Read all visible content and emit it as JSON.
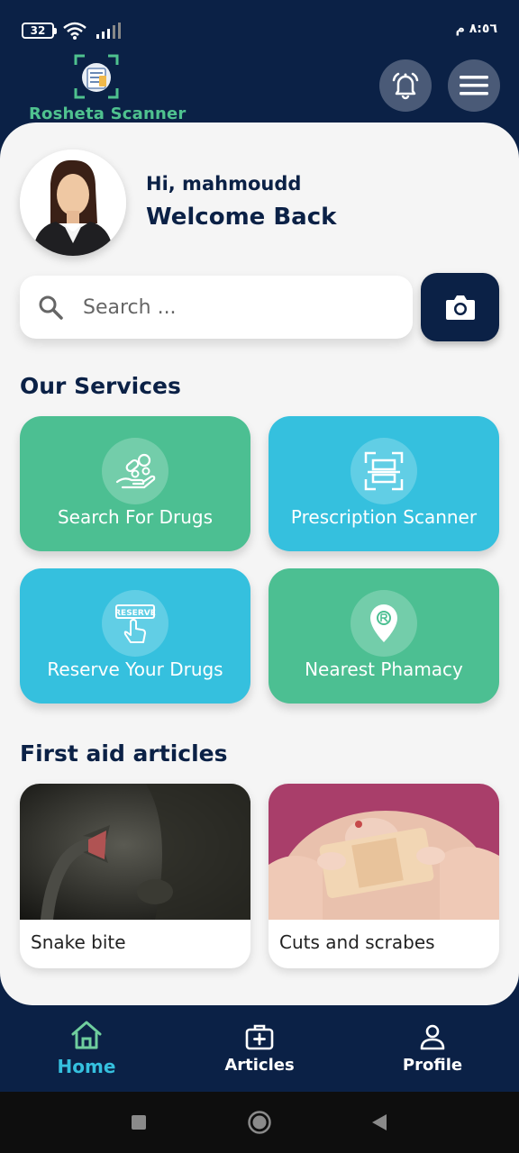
{
  "status_bar": {
    "battery": "32",
    "time": "٨:٥٦ م"
  },
  "header": {
    "app_name": "Rosheta Scanner"
  },
  "user": {
    "greeting": "Hi, mahmoudd",
    "welcome": "Welcome Back"
  },
  "search": {
    "placeholder": "Search ...",
    "value": ""
  },
  "services": {
    "title": "Our Services",
    "items": [
      {
        "label": "Search For Drugs",
        "icon": "drugs-hand-icon",
        "color": "#4cbf92"
      },
      {
        "label": "Prescription Scanner",
        "icon": "scan-frame-icon",
        "color": "#35c0de"
      },
      {
        "label": "Reserve Your Drugs",
        "icon": "reserve-sign-icon",
        "color": "#35c0de"
      },
      {
        "label": "Nearest Phamacy",
        "icon": "location-pin-icon",
        "color": "#4cbf92"
      }
    ]
  },
  "articles": {
    "title": "First aid articles",
    "items": [
      {
        "label": "Snake bite"
      },
      {
        "label": "Cuts and scrabes"
      }
    ]
  },
  "nav": {
    "items": [
      {
        "label": "Home",
        "icon": "home-icon",
        "active": true
      },
      {
        "label": "Articles",
        "icon": "medical-kit-icon",
        "active": false
      },
      {
        "label": "Profile",
        "icon": "person-icon",
        "active": false
      }
    ]
  },
  "colors": {
    "primary": "#0b2146",
    "green": "#4cbf92",
    "blue": "#35c0de",
    "background": "#f5f5f5"
  }
}
